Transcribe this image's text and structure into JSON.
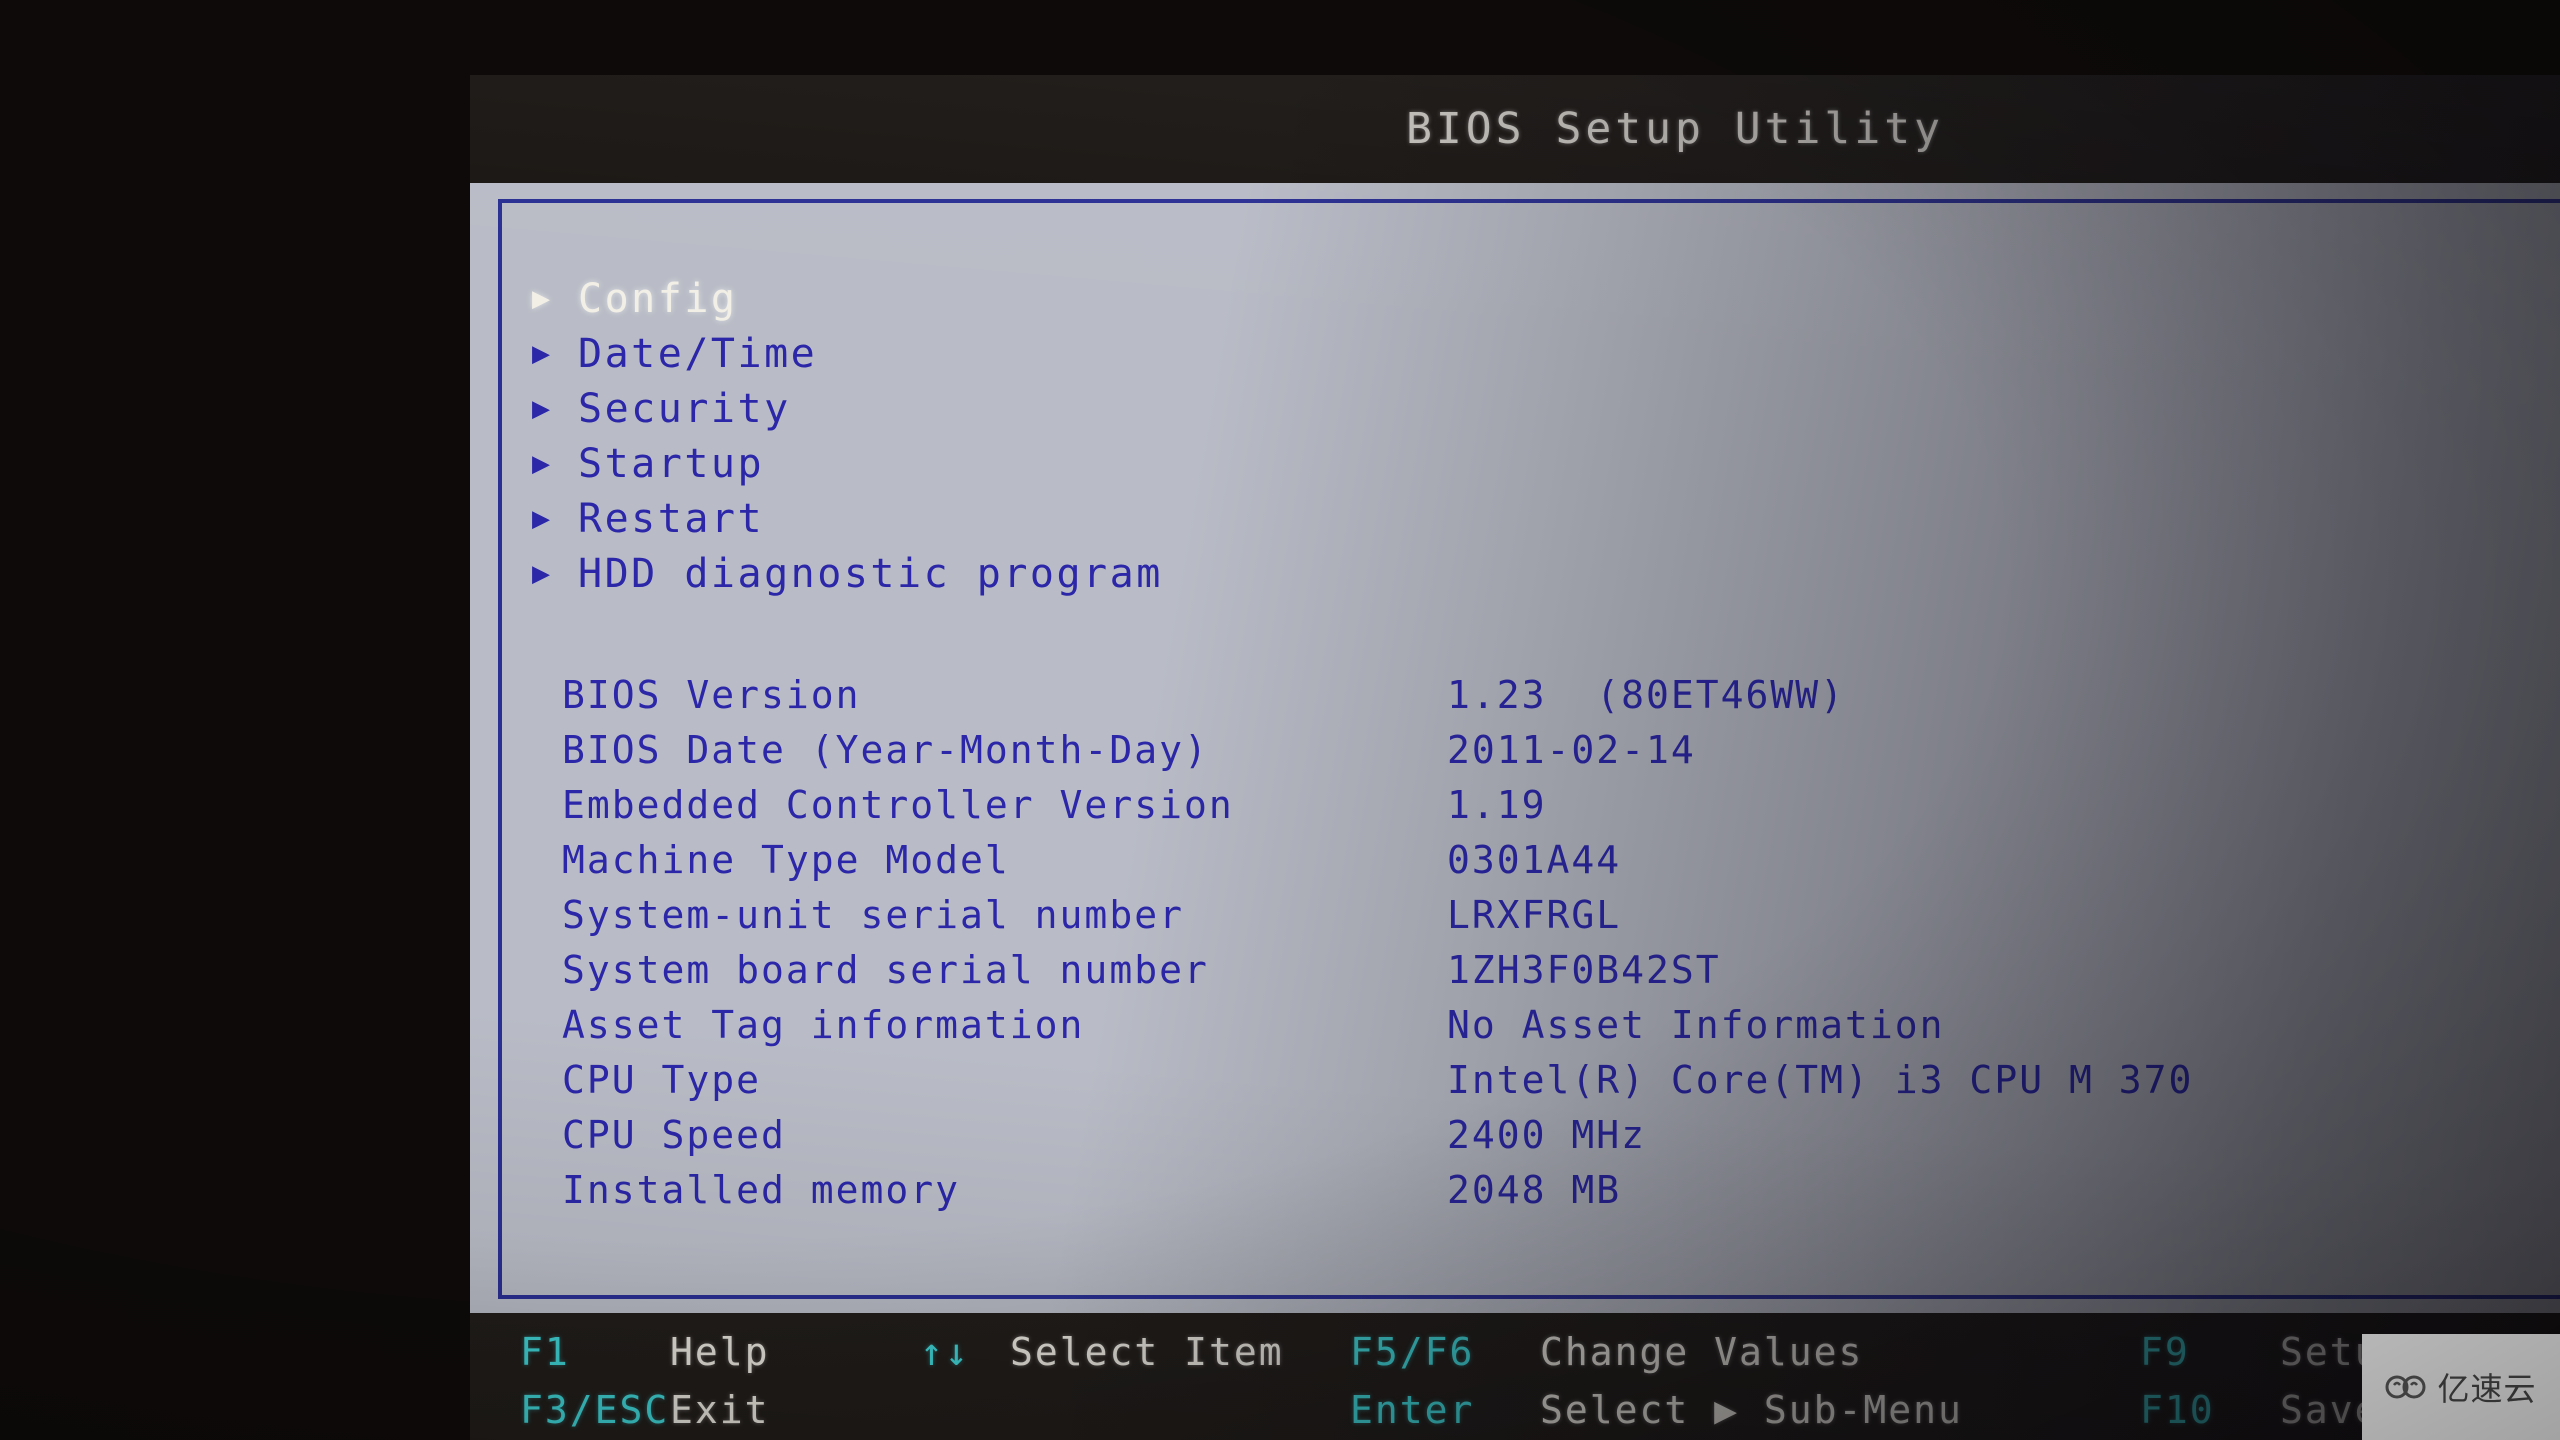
{
  "app": {
    "title": "BIOS Setup Utility"
  },
  "colors": {
    "panel_bg": "#b9bcc6",
    "text_blue": "#2b27a8",
    "selected_white": "#f2efe6",
    "frame_blue": "#2a2f93",
    "footer_bg": "#211d1a",
    "key_cyan": "#3fd2d4",
    "desc_white": "#e7e4dc",
    "surround_black": "#0d0a09"
  },
  "menu": {
    "items": [
      {
        "label": "Config",
        "marker": "▶",
        "selected": true
      },
      {
        "label": "Date/Time",
        "marker": "▶",
        "selected": false
      },
      {
        "label": "Security",
        "marker": "▶",
        "selected": false
      },
      {
        "label": "Startup",
        "marker": "▶",
        "selected": false
      },
      {
        "label": "Restart",
        "marker": "▶",
        "selected": false
      },
      {
        "label": "HDD diagnostic program",
        "marker": "▶",
        "selected": false
      }
    ]
  },
  "system_info": {
    "rows": [
      {
        "label": "BIOS Version",
        "value": "1.23  (80ET46WW)"
      },
      {
        "label": "BIOS Date (Year-Month-Day)",
        "value": "2011-02-14"
      },
      {
        "label": "Embedded Controller Version",
        "value": "1.19"
      },
      {
        "label": "Machine Type Model",
        "value": "0301A44"
      },
      {
        "label": "System-unit serial number",
        "value": "LRXFRGL"
      },
      {
        "label": "System board serial number",
        "value": "1ZH3F0B42ST"
      },
      {
        "label": "Asset Tag information",
        "value": "No Asset Information"
      },
      {
        "label": "CPU Type",
        "value": "Intel(R) Core(TM) i3 CPU M 370"
      },
      {
        "label": "CPU Speed",
        "value": "2400 MHz"
      },
      {
        "label": "Installed memory",
        "value": "2048 MB"
      }
    ]
  },
  "footer": {
    "row1": {
      "key1": "F1",
      "desc1": "Help",
      "key2": "↑↓",
      "desc2": "Select Item",
      "key3": "F5/F6",
      "desc3": "Change Values",
      "key4": "F9",
      "desc4": "Setup D"
    },
    "row2": {
      "key1": "F3/ESC",
      "desc1": "Exit",
      "key2": "",
      "desc2": "",
      "key3": "Enter",
      "desc3": "Select ▶ Sub-Menu",
      "key4": "F10",
      "desc4": "Save an"
    }
  },
  "watermark": {
    "text": "亿速云"
  }
}
